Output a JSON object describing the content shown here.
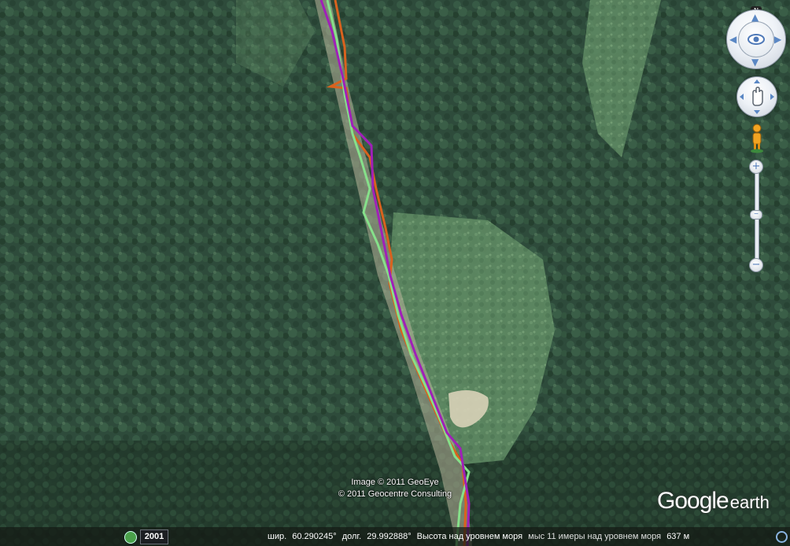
{
  "map": {
    "attribution": [
      "Image © 2011 GeoEye",
      "© 2011 Geocentre Consulting"
    ],
    "logo": {
      "main": "Google",
      "sub": "earth"
    }
  },
  "navigation": {
    "north_label": "N",
    "zoom_in_label": "+",
    "zoom_out_label": "−",
    "zoom_thumb_label": "−"
  },
  "statusbar": {
    "year": "2001",
    "lat_label": "шир.",
    "lat_value": "60.290245°",
    "lon_label": "долг.",
    "lon_value": "29.992888°",
    "elevation_label": "Высота над уровнем моря",
    "overlay_text": "мыс 11 имеры над уровнем моря",
    "eye_alt": "637 м"
  },
  "tracks": {
    "colors": {
      "purple": "#a020b8",
      "orange": "#d9621e",
      "green": "#86e08a"
    }
  }
}
